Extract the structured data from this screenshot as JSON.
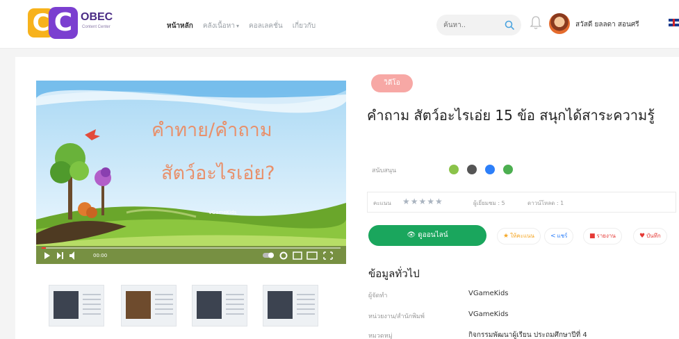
{
  "header": {
    "logo": {
      "mark": "CC",
      "word": "OBEC",
      "sub": "Content Center"
    },
    "nav": [
      {
        "label": "หน้าหลัก",
        "active": true
      },
      {
        "label": "คลังเนื้อหา",
        "active": false,
        "dropdown": true
      },
      {
        "label": "คอลเลคชั่น",
        "active": false
      },
      {
        "label": "เกี่ยวกับ",
        "active": false
      }
    ],
    "search_placeholder": "ค้นหา..",
    "user_name": "สวัสดี ยลลดา สอนศรี",
    "icons": {
      "search": "search-icon",
      "notifications": "bell-icon",
      "language": "uk-flag-icon"
    }
  },
  "video": {
    "title_line1": "คำทาย/คำถาม",
    "title_line2": "สัตว์อะไรเอ่ย?",
    "brand": "VGameKids",
    "time": "00:00",
    "controls": [
      "play-icon",
      "next-icon",
      "volume-icon",
      "autoplay-toggle",
      "settings-icon",
      "miniplayer-icon",
      "theater-icon",
      "fullscreen-icon"
    ]
  },
  "thumbnails": [
    "thumbnail-1",
    "thumbnail-2",
    "thumbnail-3",
    "thumbnail-4"
  ],
  "detail": {
    "badge": "วิดีโอ",
    "title": "คำถาม สัตว์อะไรเอ่ย 15 ข้อ สนุกได้สาระความรู้",
    "support_label": "สนับสนุน",
    "platforms": [
      {
        "name": "android-icon",
        "color": "#8bc34a"
      },
      {
        "name": "apple-icon",
        "color": "#555555"
      },
      {
        "name": "windows-icon",
        "color": "#2d7ff9"
      },
      {
        "name": "web-icon",
        "color": "#4caf50"
      }
    ],
    "rating_label": "คะแนน",
    "stars": "★★★★★",
    "viewers": "ผู้เยี่ยมชม : 5",
    "downloads": "ดาวน์โหลด : 1",
    "actions": {
      "download": "ดูออนไลน์",
      "rate": "ให้คะแนน",
      "share": "แชร์",
      "report": "รายงาน",
      "favorite": "บันทึก"
    },
    "section_title": "ข้อมูลทั่วไป",
    "info": [
      {
        "label": "ผู้จัดทำ",
        "value": "VGameKids"
      },
      {
        "label": "หน่วยงาน/สำนักพิมพ์",
        "value": "VGameKids"
      },
      {
        "label": "หมวดหมู่",
        "value": "กิจกรรมพัฒนาผู้เรียน ประถมศึกษาปีที่ 4"
      }
    ]
  },
  "colors": {
    "accent": "#1aa65d",
    "badge": "#f7a8a5",
    "brand_purple": "#7b3fd0",
    "brand_yellow": "#f7b21c"
  }
}
